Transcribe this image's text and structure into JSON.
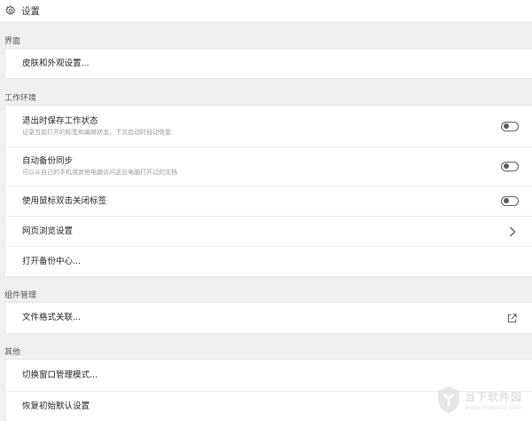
{
  "window": {
    "title": "设置",
    "icon": "gear-icon"
  },
  "sections": {
    "interface": {
      "label": "界面",
      "rows": [
        {
          "label": "皮肤和外观设置..."
        }
      ]
    },
    "workspace": {
      "label": "工作环境",
      "rows": [
        {
          "label": "退出时保存工作状态",
          "desc": "记录当前打开的标签和编辑状态，下次启动时自动恢复",
          "control": "toggle",
          "value": false
        },
        {
          "label": "自动备份同步",
          "desc": "可以从自己的手机或其他电脑访问这台电脑打开过的文档",
          "control": "toggle",
          "value": false
        },
        {
          "label": "使用鼠标双击关闭标签",
          "control": "toggle",
          "value": false
        },
        {
          "label": "网页浏览设置",
          "control": "chevron-right-icon"
        },
        {
          "label": "打开备份中心..."
        }
      ]
    },
    "components": {
      "label": "组件管理",
      "rows": [
        {
          "label": "文件格式关联...",
          "control": "external-link-icon"
        }
      ]
    },
    "other": {
      "label": "其他",
      "rows": [
        {
          "label": "切换窗口管理模式..."
        },
        {
          "label": "恢复初始默认设置"
        }
      ]
    }
  },
  "watermark": {
    "text": "当下软件园",
    "subtext": "www.downxia.com"
  },
  "colors": {
    "background": "#f0f0f0",
    "card": "#ffffff",
    "toggle": "#5a5a5a"
  }
}
